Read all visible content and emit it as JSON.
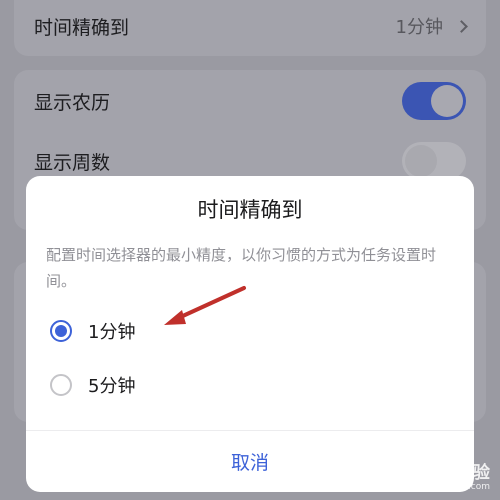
{
  "settings": {
    "precision_row": {
      "label": "时间精确到",
      "value": "1分钟"
    },
    "show_lunar": {
      "label": "显示农历",
      "enabled": true
    },
    "show_week": {
      "label": "显示周数",
      "enabled": false
    }
  },
  "dialog": {
    "title": "时间精确到",
    "description": "配置时间选择器的最小精度，以你习惯的方式为任务设置时间。",
    "options": [
      {
        "label": "1分钟",
        "selected": true
      },
      {
        "label": "5分钟",
        "selected": false
      }
    ],
    "cancel_label": "取消"
  },
  "watermark": {
    "logo": "Bai du 经验",
    "url": "jingyan.baidu.com"
  },
  "colors": {
    "accent": "#3d62d8",
    "annotation_arrow": "#c0302b"
  }
}
